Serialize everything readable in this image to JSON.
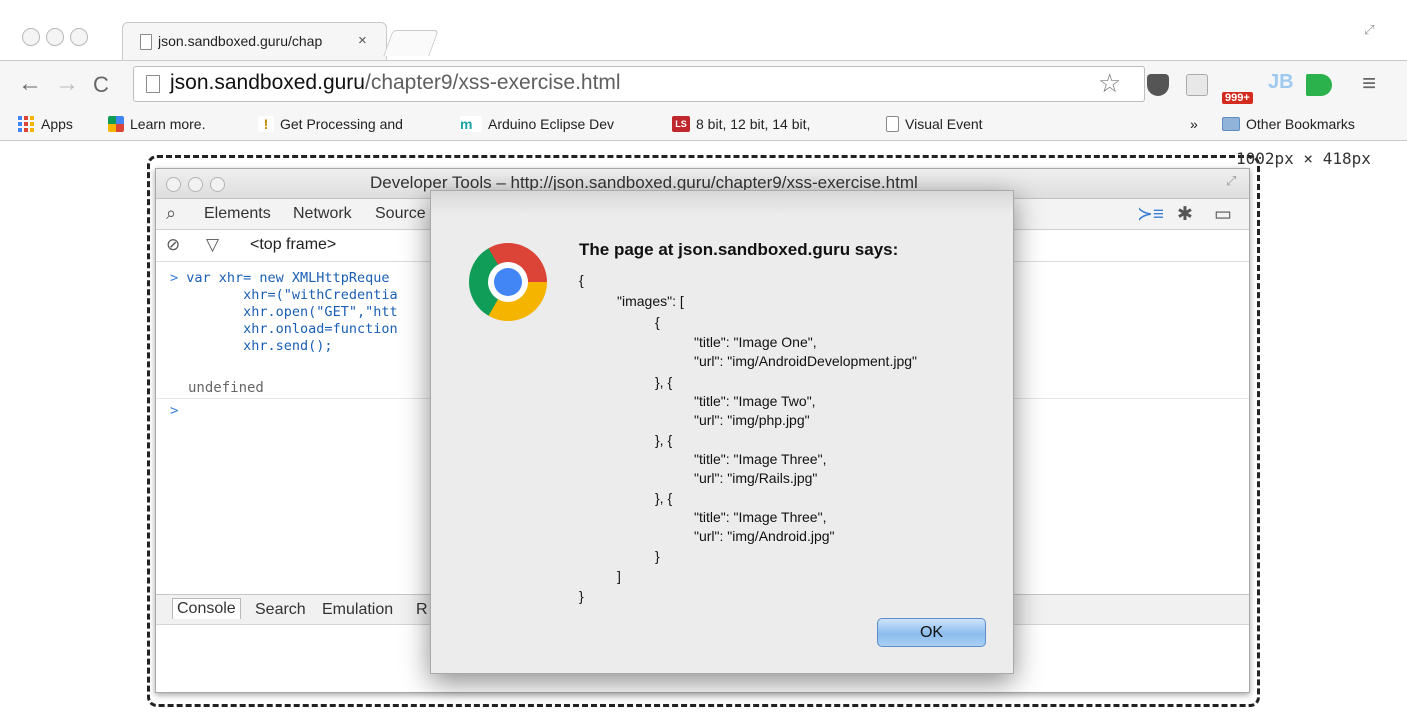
{
  "browser": {
    "tab_title": "json.sandboxed.guru/chap",
    "tab_close": "×",
    "url_host": "json.sandboxed.guru",
    "url_path": "/chapter9/xss-exercise.html",
    "ext_badge": "999+",
    "bookmarks": [
      {
        "label": "Apps",
        "icon": "apps-grid-icon"
      },
      {
        "label": "Learn more.",
        "icon": "puzzle-icon"
      },
      {
        "label": "Get Processing and",
        "icon": "processing-icon"
      },
      {
        "label": "Arduino Eclipse Dev",
        "icon": "arduino-icon"
      },
      {
        "label": "8 bit, 12 bit, 14 bit,",
        "icon": "ls-icon"
      },
      {
        "label": "Visual Event",
        "icon": "page-icon"
      }
    ],
    "bookmarks_overflow": "»",
    "other_bookmarks": "Other Bookmarks"
  },
  "viewport_size_label": "1002px × 418px",
  "devtools": {
    "title": "Developer Tools – http://json.sandboxed.guru/chapter9/xss-exercise.html",
    "tabs": [
      "Elements",
      "Network",
      "Source"
    ],
    "frame_selector": "<top frame>",
    "console_lines": [
      "var xhr= new XMLHttpReque",
      "       xhr=(\"withCredentia",
      "       xhr.open(\"GET\",\"htt",
      "       xhr.onload=function",
      "       xhr.send();"
    ],
    "prompt": ">",
    "result": "undefined",
    "drawer_tabs": [
      "Console",
      "Search",
      "Emulation",
      "R"
    ]
  },
  "alert": {
    "title": "The page at json.sandboxed.guru says:",
    "message_lines": [
      "{",
      "\"images\": [",
      "{",
      "\"title\": \"Image One\",",
      "\"url\": \"img/AndroidDevelopment.jpg\"",
      "}, {",
      "\"title\": \"Image Two\",",
      "\"url\": \"img/php.jpg\"",
      "}, {",
      "\"title\": \"Image Three\",",
      "\"url\": \"img/Rails.jpg\"",
      "}, {",
      "\"title\": \"Image Three\",",
      "\"url\": \"img/Android.jpg\"",
      "}",
      "]",
      "}"
    ],
    "ok_label": "OK"
  }
}
